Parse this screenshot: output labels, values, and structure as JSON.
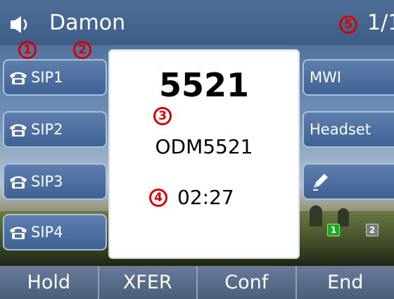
{
  "status_bar": {
    "account_name": "Damon",
    "page_indicator": "1/1",
    "speaker_icon": "speaker-icon"
  },
  "markers": [
    "1",
    "2",
    "3",
    "4",
    "5"
  ],
  "line_keys_left": [
    {
      "label": "SIP1",
      "icon": "phone-icon"
    },
    {
      "label": "SIP2",
      "icon": "phone-icon"
    },
    {
      "label": "SIP3",
      "icon": "phone-icon"
    },
    {
      "label": "SIP4",
      "icon": "phone-icon"
    }
  ],
  "line_keys_right": [
    {
      "label": "MWI"
    },
    {
      "label": "Headset"
    },
    {
      "label": "",
      "icon": "pencil-icon"
    }
  ],
  "call": {
    "number": "5521",
    "name": "ODM5521",
    "duration": "02:27"
  },
  "line_indicators": [
    {
      "label": "1",
      "color": "#1fa81f"
    },
    {
      "label": "2",
      "color": "#7a7a7a"
    }
  ],
  "softkeys": [
    "Hold",
    "XFER",
    "Conf",
    "End"
  ],
  "colors": {
    "marker": "#d80000",
    "key_fill": "#4f71a2",
    "softkey_fill": "#55698a"
  }
}
